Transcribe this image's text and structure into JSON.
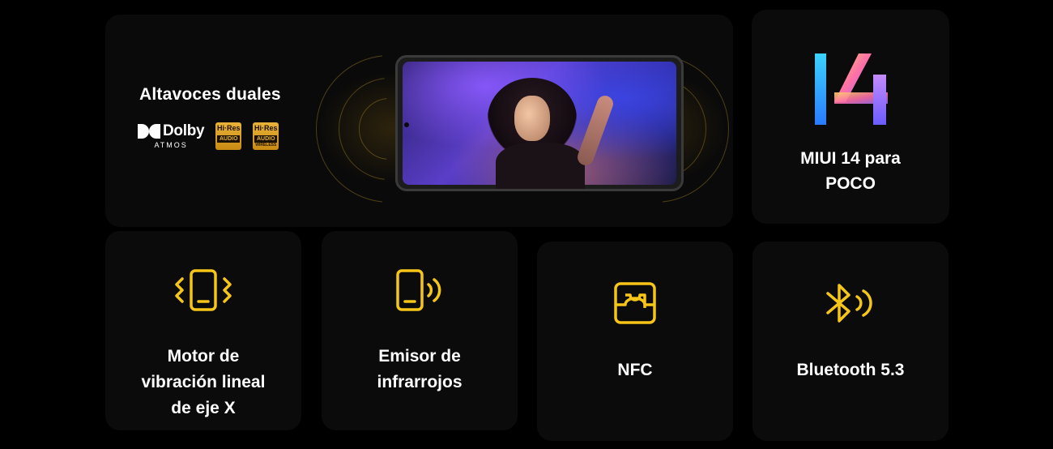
{
  "colors": {
    "accent": "#f5c518",
    "background": "#000000",
    "card": "#0b0b0b"
  },
  "speakers": {
    "title": "Altavoces duales",
    "dolby": {
      "brand": "Dolby",
      "sub": "ATMOS"
    },
    "hires_badges": [
      {
        "top": "Hi·Res",
        "bottom": "AUDIO",
        "extra": ""
      },
      {
        "top": "Hi·Res",
        "bottom": "AUDIO",
        "extra": "WIRELESS"
      }
    ]
  },
  "miui": {
    "logo_text": "14",
    "title": "MIUI 14 para\nPOCO"
  },
  "features": [
    {
      "icon": "vibration-phone-icon",
      "title": "Motor de\nvibración lineal\nde eje X"
    },
    {
      "icon": "infrared-phone-icon",
      "title": "Emisor de\ninfrarrojos"
    },
    {
      "icon": "nfc-icon",
      "title": "NFC"
    },
    {
      "icon": "bluetooth-icon",
      "title": "Bluetooth 5.3"
    }
  ]
}
